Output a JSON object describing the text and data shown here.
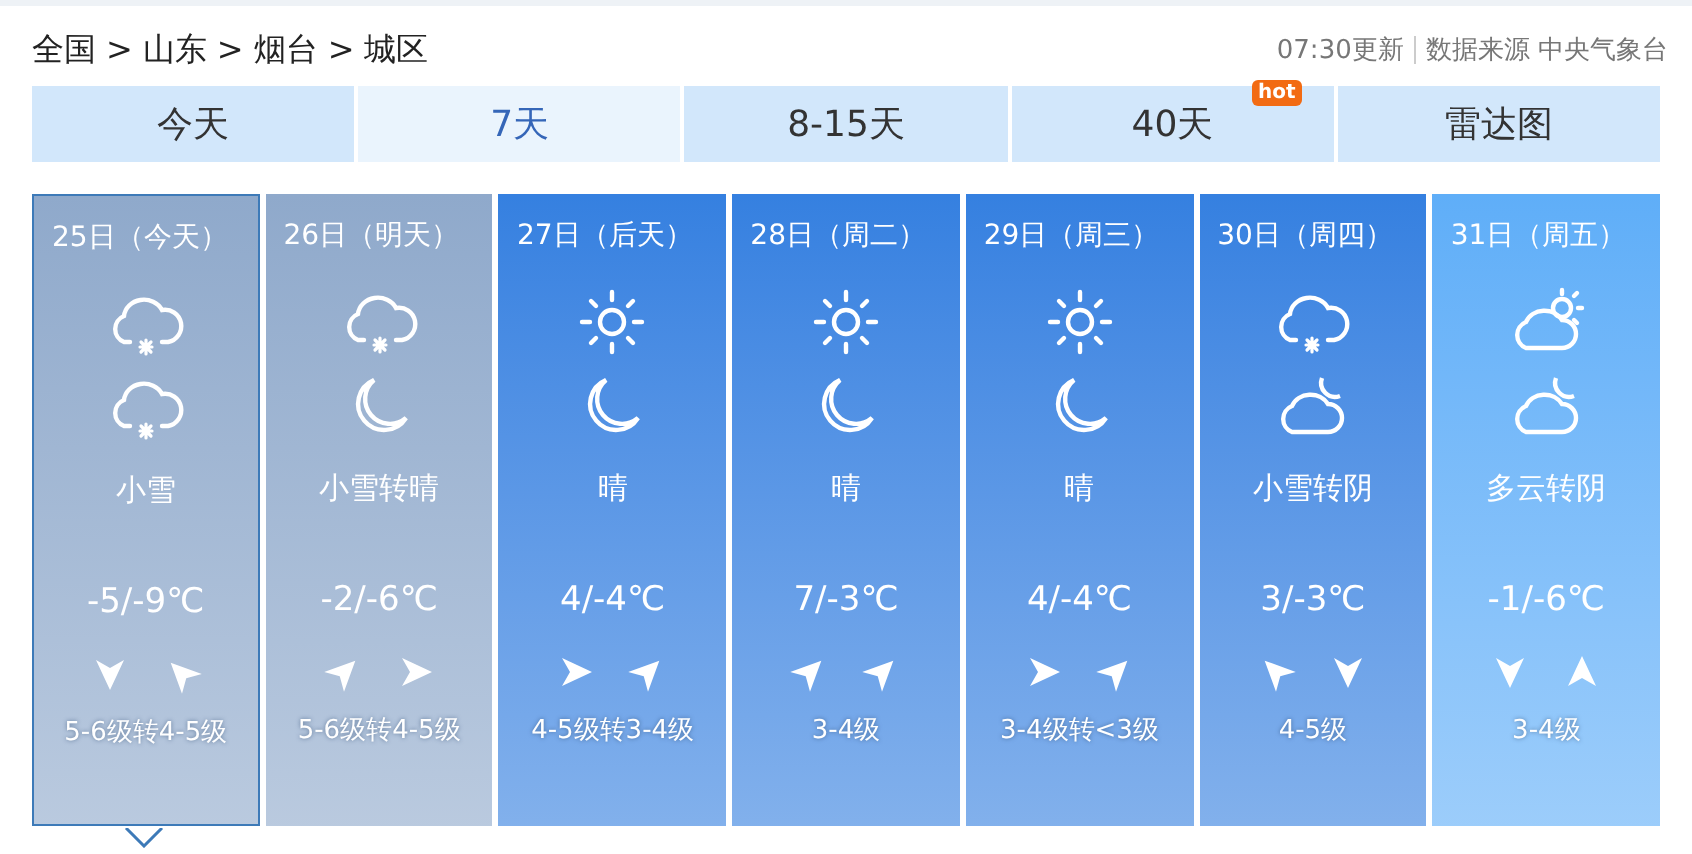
{
  "breadcrumb": [
    "全国",
    ">",
    "山东",
    ">",
    "烟台",
    ">",
    "城区"
  ],
  "update": {
    "time": "07:30更新",
    "source": "数据来源 中央气象台"
  },
  "tabs": [
    {
      "label": "今天",
      "selected": false
    },
    {
      "label": "7天",
      "selected": true
    },
    {
      "label": "8-15天",
      "selected": false
    },
    {
      "label": "40天",
      "selected": false,
      "badge": "hot"
    },
    {
      "label": "雷达图",
      "selected": false
    }
  ],
  "days": [
    {
      "date": "25日（今天）",
      "selected": true,
      "color": "#8fa9cb",
      "icons": [
        {
          "kind": "snow"
        },
        {
          "kind": "snow"
        }
      ],
      "weather": "小雪",
      "temp": "-5/-9℃",
      "winds": [
        {
          "kind": "down"
        },
        {
          "kind": "upleft"
        }
      ],
      "wind_level": "5-6级转4-5级"
    },
    {
      "date": "26日（明天）",
      "selected": false,
      "color": "#8fa9cb",
      "icons": [
        {
          "kind": "snow"
        },
        {
          "kind": "moon"
        }
      ],
      "weather": "小雪转晴",
      "temp": "-2/-6℃",
      "winds": [
        {
          "kind": "upright"
        },
        {
          "kind": "right"
        }
      ],
      "wind_level": "5-6级转4-5级"
    },
    {
      "date": "27日（后天）",
      "selected": false,
      "color": "#3580e0",
      "icons": [
        {
          "kind": "sun"
        },
        {
          "kind": "moon"
        }
      ],
      "weather": "晴",
      "temp": "4/-4℃",
      "winds": [
        {
          "kind": "right"
        },
        {
          "kind": "upright"
        }
      ],
      "wind_level": "4-5级转3-4级"
    },
    {
      "date": "28日（周二）",
      "selected": false,
      "color": "#3580e0",
      "icons": [
        {
          "kind": "sun"
        },
        {
          "kind": "moon"
        }
      ],
      "weather": "晴",
      "temp": "7/-3℃",
      "winds": [
        {
          "kind": "upright"
        },
        {
          "kind": "upright"
        }
      ],
      "wind_level": "3-4级"
    },
    {
      "date": "29日（周三）",
      "selected": false,
      "color": "#3580e0",
      "icons": [
        {
          "kind": "sun"
        },
        {
          "kind": "moon"
        }
      ],
      "weather": "晴",
      "temp": "4/-4℃",
      "winds": [
        {
          "kind": "right"
        },
        {
          "kind": "upright"
        }
      ],
      "wind_level": "3-4级转<3级"
    },
    {
      "date": "30日（周四）",
      "selected": false,
      "color": "#3580e0",
      "icons": [
        {
          "kind": "snow"
        },
        {
          "kind": "cloudmoon"
        }
      ],
      "weather": "小雪转阴",
      "temp": "3/-3℃",
      "winds": [
        {
          "kind": "upleft"
        },
        {
          "kind": "down"
        }
      ],
      "wind_level": "4-5级"
    },
    {
      "date": "31日（周五）",
      "selected": false,
      "color": "#5faef8",
      "icons": [
        {
          "kind": "cloudsun"
        },
        {
          "kind": "cloudmoon"
        }
      ],
      "weather": "多云转阴",
      "temp": "-1/-6℃",
      "winds": [
        {
          "kind": "down"
        },
        {
          "kind": "up"
        }
      ],
      "wind_level": "3-4级"
    }
  ]
}
